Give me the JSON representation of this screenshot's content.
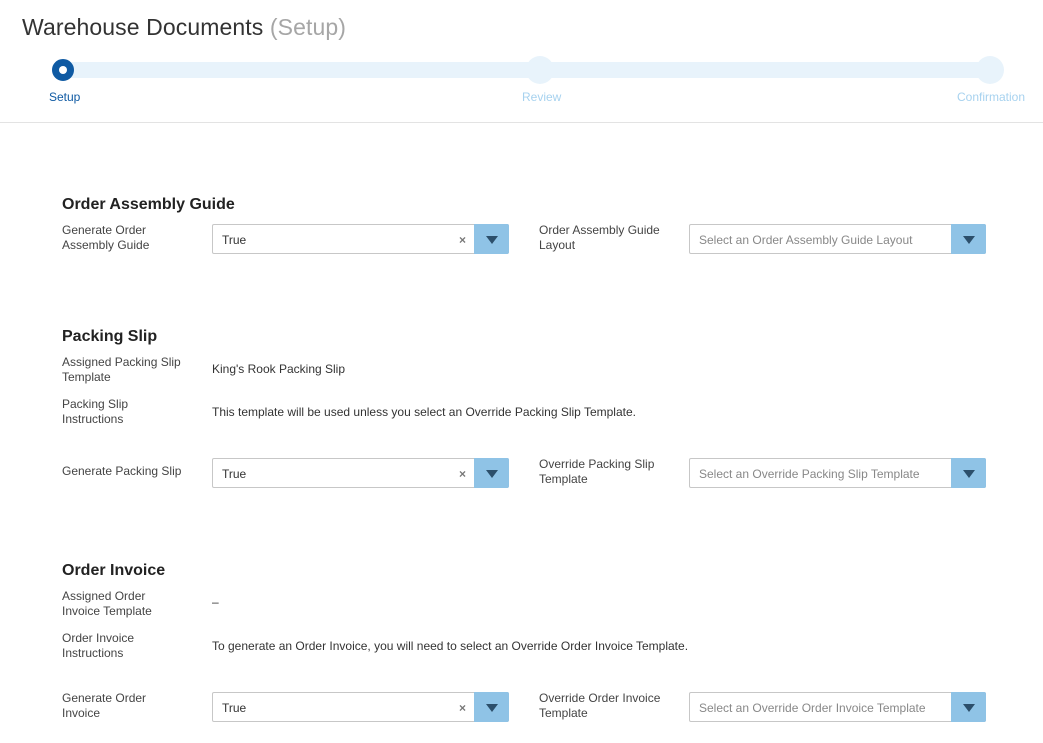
{
  "page": {
    "title": "Warehouse Documents",
    "title_suffix": "(Setup)"
  },
  "steps": [
    {
      "label": "Setup",
      "state": "active"
    },
    {
      "label": "Review",
      "state": "pending"
    },
    {
      "label": "Confirmation",
      "state": "pending"
    }
  ],
  "assembly": {
    "heading": "Order Assembly Guide",
    "generate_label": "Generate Order Assembly Guide",
    "generate_value": "True",
    "layout_label": "Order Assembly Guide Layout",
    "layout_placeholder": "Select an Order Assembly Guide Layout"
  },
  "packing": {
    "heading": "Packing Slip",
    "assigned_label": "Assigned Packing Slip Template",
    "assigned_value": "King's Rook Packing Slip",
    "instructions_label": "Packing Slip Instructions",
    "instructions_value": "This template will be used unless you select an Override Packing Slip Template.",
    "generate_label": "Generate Packing Slip",
    "generate_value": "True",
    "override_label": "Override Packing Slip Template",
    "override_placeholder": "Select an Override Packing Slip Template"
  },
  "invoice": {
    "heading": "Order Invoice",
    "assigned_label": "Assigned Order Invoice Template",
    "assigned_value": "–",
    "instructions_label": "Order Invoice Instructions",
    "instructions_value": "To generate an Order Invoice, you will need to select an Override Order Invoice Template.",
    "generate_label": "Generate Order Invoice",
    "generate_value": "True",
    "override_label": "Override Order Invoice Template",
    "override_placeholder": "Select an Override Order Invoice Template"
  },
  "icons": {
    "clear": "×"
  }
}
